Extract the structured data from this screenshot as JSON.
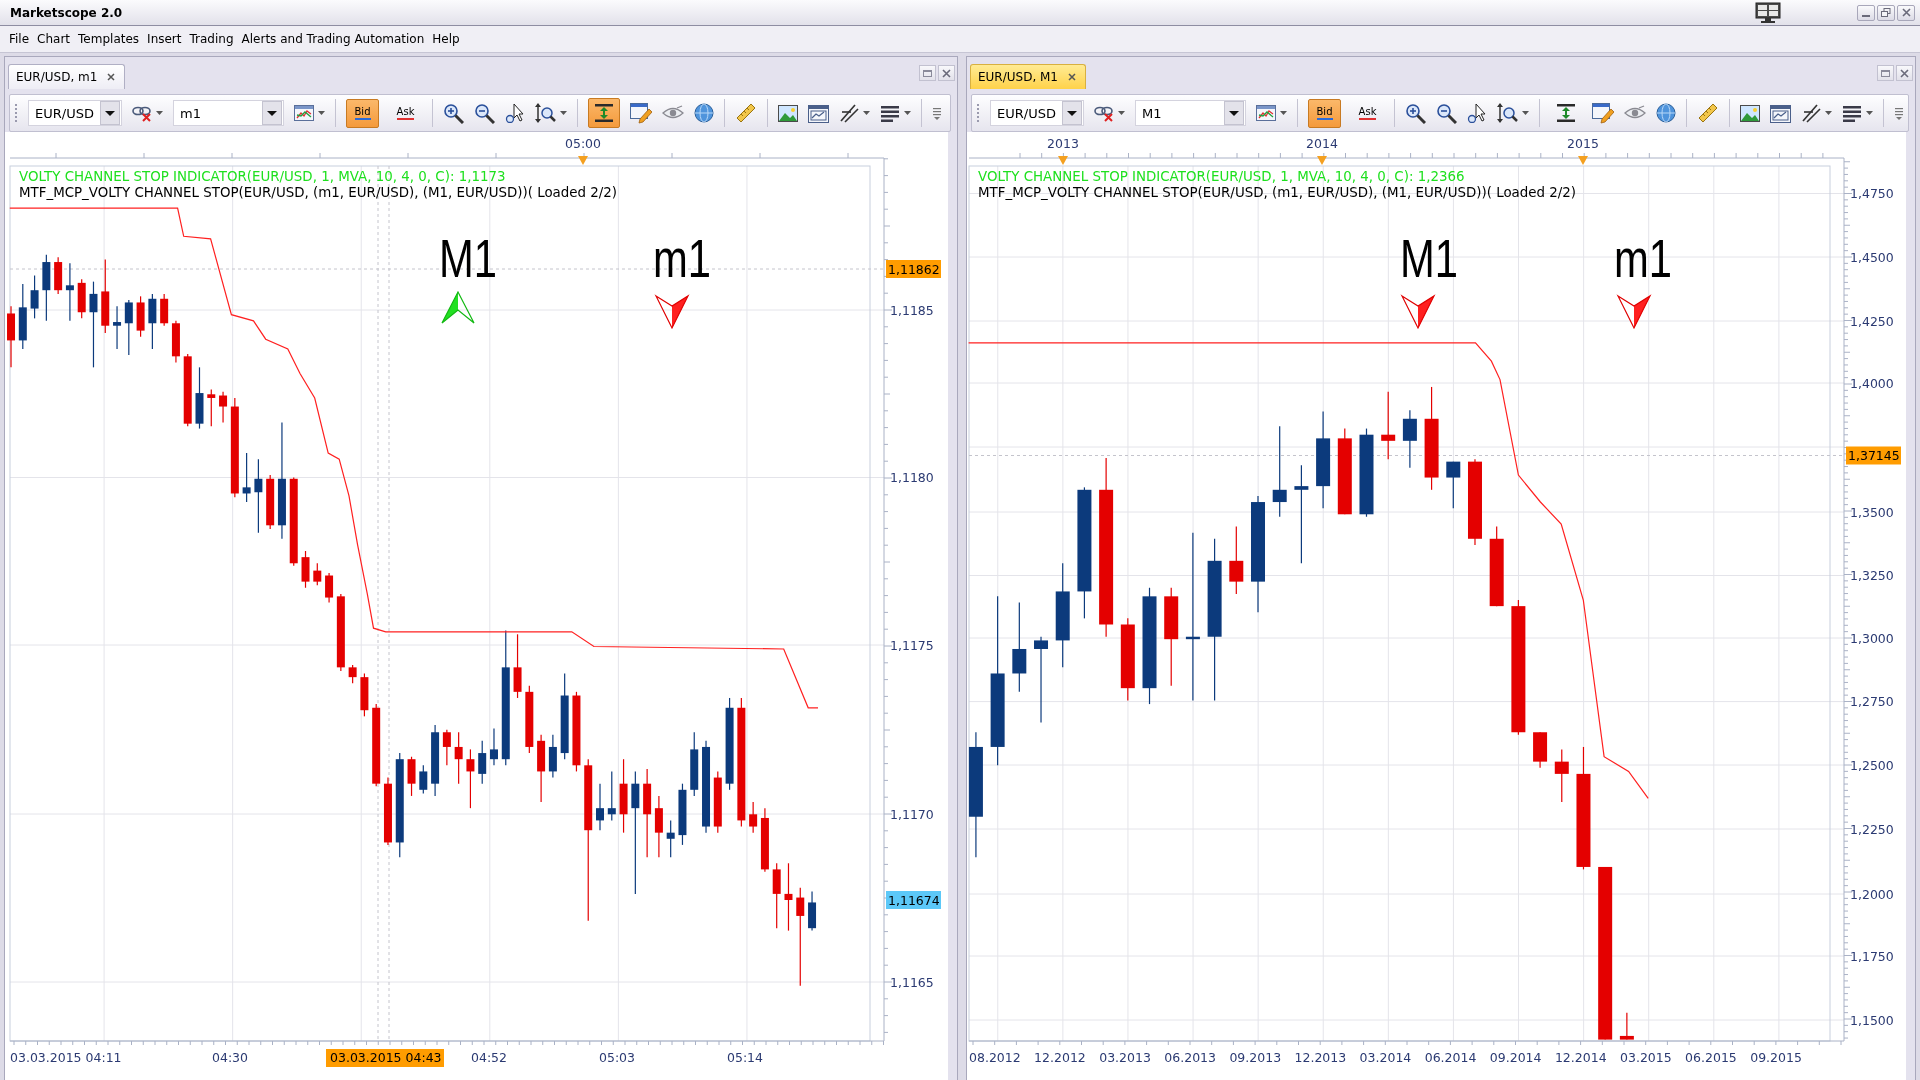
{
  "window": {
    "title": "Marketscope 2.0"
  },
  "menu": [
    "File",
    "Chart",
    "Templates",
    "Insert",
    "Trading",
    "Alerts and Trading Automation",
    "Help"
  ],
  "panels": [
    {
      "tab": {
        "label": "EUR/USD, m1",
        "selected": false
      },
      "toolbar": {
        "symbol": "EUR/USD",
        "timeframe": "m1",
        "price_buttons": [
          {
            "label": "Bid",
            "selected": true
          },
          {
            "label": "Ask",
            "selected": false
          }
        ],
        "autoscale": {
          "on": true
        }
      },
      "chart": {
        "top_axis_labels": [
          "05:00"
        ],
        "legend": [
          {
            "text": "VOLTY CHANNEL STOP INDICATOR(EUR/USD, 1, MVA, 10, 4, 0, C): 1,1173",
            "color": "#1ee01e"
          },
          {
            "text": "MTF_MCP_VOLTY CHANNEL STOP(EUR/USD, (m1, EUR/USD), (M1, EUR/USD))( Loaded 2/2)",
            "color": "#000000"
          }
        ],
        "signals": [
          {
            "label": "M1",
            "kind": "up"
          },
          {
            "label": "m1",
            "kind": "down"
          }
        ],
        "price_axis_labels": [
          "1,1185",
          "1,1180",
          "1,1175",
          "1,1170",
          "1,1165"
        ],
        "price_tags": [
          {
            "text": "1,11862",
            "color": "#ff9c00"
          },
          {
            "text": "1,11674",
            "color": "#5cc8f8"
          }
        ],
        "time_axis_labels": [
          {
            "text": "03.03.2015 04:11",
            "highlighted": false
          },
          {
            "text": "04:30",
            "highlighted": false
          },
          {
            "text": "03.03.2015 04:43",
            "highlighted": true
          },
          {
            "text": "04:52",
            "highlighted": false
          },
          {
            "text": "05:03",
            "highlighted": false
          },
          {
            "text": "05:14",
            "highlighted": false
          }
        ]
      }
    },
    {
      "tab": {
        "label": "EUR/USD, M1",
        "selected": true
      },
      "toolbar": {
        "symbol": "EUR/USD",
        "timeframe": "M1",
        "price_buttons": [
          {
            "label": "Bid",
            "selected": true
          },
          {
            "label": "Ask",
            "selected": false
          }
        ],
        "autoscale": {
          "on": false
        }
      },
      "chart": {
        "top_axis_labels": [
          "2013",
          "2014",
          "2015"
        ],
        "legend": [
          {
            "text": "VOLTY CHANNEL STOP INDICATOR(EUR/USD, 1, MVA, 10, 4, 0, C): 1,2366",
            "color": "#1ee01e"
          },
          {
            "text": "MTF_MCP_VOLTY CHANNEL STOP(EUR/USD, (m1, EUR/USD), (M1, EUR/USD))( Loaded 2/2)",
            "color": "#000000"
          }
        ],
        "signals": [
          {
            "label": "M1",
            "kind": "down"
          },
          {
            "label": "m1",
            "kind": "down"
          }
        ],
        "price_axis_labels": [
          "1,4750",
          "1,4500",
          "1,4250",
          "1,4000",
          "1,3500",
          "1,3250",
          "1,3000",
          "1,2750",
          "1,2500",
          "1,2250",
          "1,2000",
          "1,1750",
          "1,1500"
        ],
        "price_tags": [
          {
            "text": "1,37145",
            "color": "#ff9c00"
          }
        ],
        "time_axis_labels": [
          {
            "text": "08.2012",
            "highlighted": false
          },
          {
            "text": "12.2012",
            "highlighted": false
          },
          {
            "text": "03.2013",
            "highlighted": false
          },
          {
            "text": "06.2013",
            "highlighted": false
          },
          {
            "text": "09.2013",
            "highlighted": false
          },
          {
            "text": "12.2013",
            "highlighted": false
          },
          {
            "text": "03.2014",
            "highlighted": false
          },
          {
            "text": "06.2014",
            "highlighted": false
          },
          {
            "text": "09.2014",
            "highlighted": false
          },
          {
            "text": "12.2014",
            "highlighted": false
          },
          {
            "text": "03.2015",
            "highlighted": false
          },
          {
            "text": "06.2015",
            "highlighted": false
          },
          {
            "text": "09.2015",
            "highlighted": false
          }
        ]
      }
    }
  ]
}
